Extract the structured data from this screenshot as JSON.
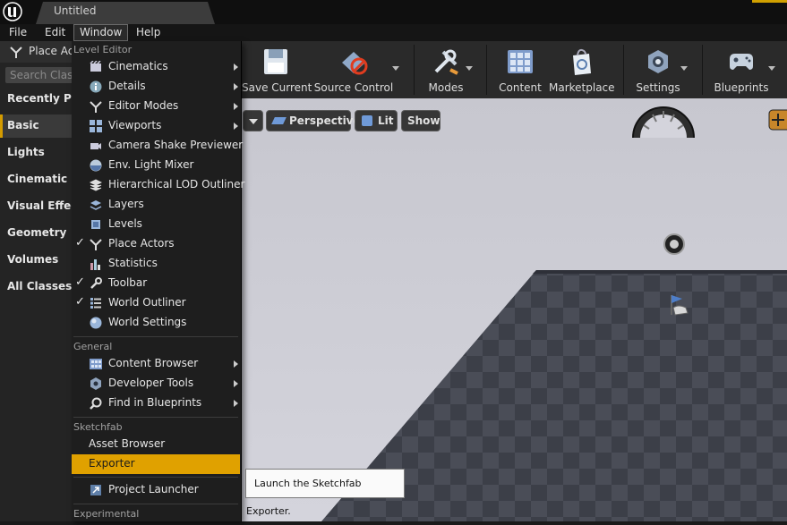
{
  "window": {
    "tab_title": "Untitled"
  },
  "menubar": {
    "items": [
      "File",
      "Edit",
      "Window",
      "Help"
    ]
  },
  "left_panel": {
    "tab_label": "Place Ac",
    "search_placeholder": "Search Class",
    "categories": [
      "Recently Pla",
      "Basic",
      "Lights",
      "Cinematic",
      "Visual Effect",
      "Geometry",
      "Volumes",
      "All Classes"
    ]
  },
  "toolbar": {
    "buttons": [
      {
        "label": "Save Current",
        "icon": "save-icon"
      },
      {
        "label": "Source Control",
        "icon": "source-control-icon"
      },
      {
        "label": "Modes",
        "icon": "modes-icon"
      },
      {
        "label": "Content",
        "icon": "content-icon"
      },
      {
        "label": "Marketplace",
        "icon": "marketplace-icon"
      },
      {
        "label": "Settings",
        "icon": "settings-icon"
      },
      {
        "label": "Blueprints",
        "icon": "blueprints-icon"
      }
    ]
  },
  "viewport": {
    "perspective": "Perspective",
    "lit": "Lit",
    "show": "Show"
  },
  "dropdown": {
    "sections": [
      {
        "header": "Level Editor",
        "items": [
          {
            "label": "Cinematics",
            "icon": "cinematics-icon",
            "checked": false,
            "submenu": true
          },
          {
            "label": "Details",
            "icon": "details-icon",
            "checked": false,
            "submenu": true
          },
          {
            "label": "Editor Modes",
            "icon": "editor-modes-icon",
            "checked": false,
            "submenu": true
          },
          {
            "label": "Viewports",
            "icon": "viewports-icon",
            "checked": false,
            "submenu": true
          },
          {
            "label": "Camera Shake Previewer",
            "icon": "camera-shake-icon",
            "checked": false,
            "submenu": false
          },
          {
            "label": "Env. Light Mixer",
            "icon": "light-mixer-icon",
            "checked": false,
            "submenu": false
          },
          {
            "label": "Hierarchical LOD Outliner",
            "icon": "lod-icon",
            "checked": false,
            "submenu": false
          },
          {
            "label": "Layers",
            "icon": "layers-icon",
            "checked": false,
            "submenu": false
          },
          {
            "label": "Levels",
            "icon": "levels-icon",
            "checked": false,
            "submenu": false
          },
          {
            "label": "Place Actors",
            "icon": "place-actors-icon",
            "checked": true,
            "submenu": false
          },
          {
            "label": "Statistics",
            "icon": "statistics-icon",
            "checked": false,
            "submenu": false
          },
          {
            "label": "Toolbar",
            "icon": "toolbar-icon",
            "checked": true,
            "submenu": false
          },
          {
            "label": "World Outliner",
            "icon": "world-outliner-icon",
            "checked": true,
            "submenu": false
          },
          {
            "label": "World Settings",
            "icon": "world-settings-icon",
            "checked": false,
            "submenu": false
          }
        ]
      },
      {
        "header": "General",
        "items": [
          {
            "label": "Content Browser",
            "icon": "content-browser-icon",
            "checked": false,
            "submenu": true
          },
          {
            "label": "Developer Tools",
            "icon": "developer-tools-icon",
            "checked": false,
            "submenu": true
          },
          {
            "label": "Find in Blueprints",
            "icon": "find-blueprints-icon",
            "checked": false,
            "submenu": true
          }
        ]
      },
      {
        "header": "Sketchfab",
        "items": [
          {
            "label": "Asset Browser",
            "icon": "",
            "checked": false,
            "submenu": false
          },
          {
            "label": "Exporter",
            "icon": "",
            "checked": false,
            "submenu": false,
            "highlighted": true
          }
        ]
      },
      {
        "header": "",
        "items": [
          {
            "label": "Project Launcher",
            "icon": "project-launcher-icon",
            "checked": false,
            "submenu": false
          }
        ]
      },
      {
        "header": "Experimental",
        "items": []
      }
    ]
  },
  "tooltip": "Launch the Sketchfab Exporter."
}
